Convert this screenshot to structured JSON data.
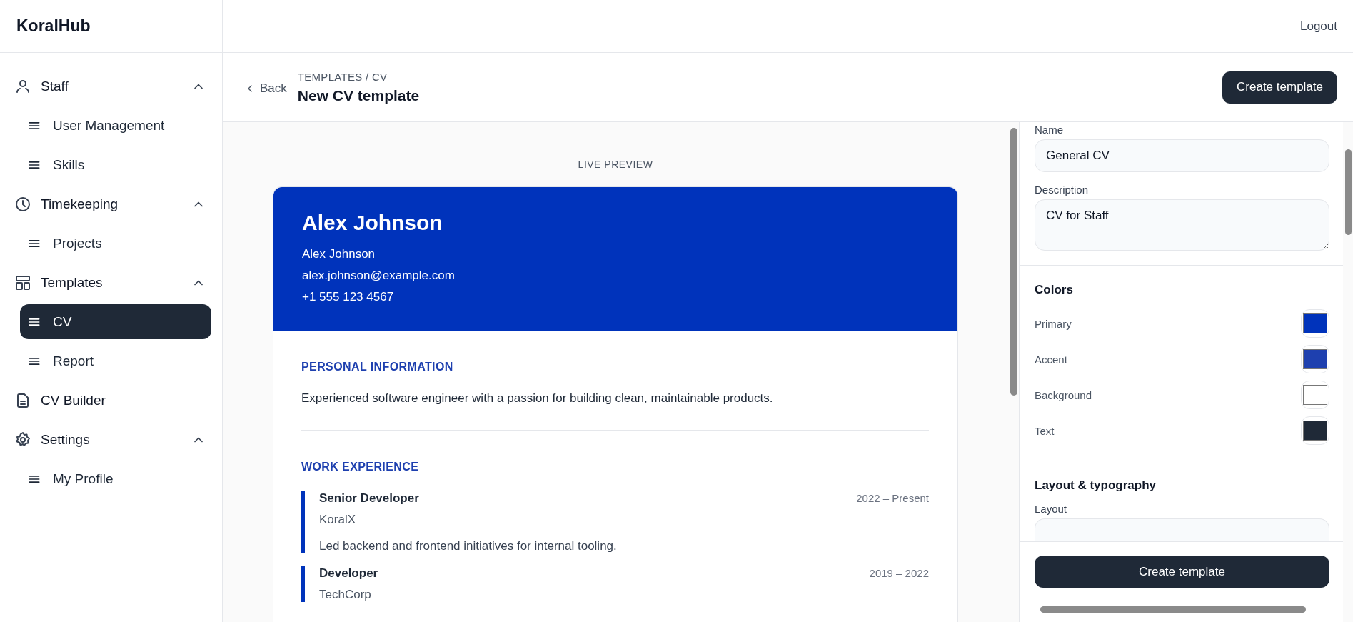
{
  "brand": "KoralHub",
  "topbar": {
    "logout": "Logout"
  },
  "sidebar": {
    "items": [
      {
        "kind": "group",
        "label": "Staff",
        "expanded": true,
        "children": [
          {
            "label": "User Management",
            "selected": false
          },
          {
            "label": "Skills",
            "selected": false
          }
        ]
      },
      {
        "kind": "group",
        "label": "Timekeeping",
        "expanded": true,
        "children": [
          {
            "label": "Projects",
            "selected": false
          }
        ]
      },
      {
        "kind": "group",
        "label": "Templates",
        "expanded": true,
        "children": [
          {
            "label": "CV",
            "selected": true
          },
          {
            "label": "Report",
            "selected": false
          }
        ]
      },
      {
        "kind": "link",
        "label": "CV Builder",
        "selected": false
      },
      {
        "kind": "group",
        "label": "Settings",
        "expanded": true,
        "children": [
          {
            "label": "My Profile",
            "selected": false
          }
        ]
      }
    ]
  },
  "header": {
    "back": "Back",
    "breadcrumb": "TEMPLATES / CV",
    "title": "New CV template",
    "action": "Create template"
  },
  "preview": {
    "label": "LIVE PREVIEW",
    "cv": {
      "name": "Alex Johnson",
      "contact": [
        "Alex Johnson",
        "alex.johnson@example.com",
        "+1 555 123 4567"
      ],
      "sections": [
        {
          "kind": "text",
          "title": "PERSONAL INFORMATION",
          "text": "Experienced software engineer with a passion for building clean, maintainable products."
        },
        {
          "kind": "entries",
          "title": "WORK EXPERIENCE",
          "entries": [
            {
              "role": "Senior Developer",
              "period": "2022 – Present",
              "company": "KoralX",
              "description": "Led backend and frontend initiatives for internal tooling."
            },
            {
              "role": "Developer",
              "period": "2019 – 2022",
              "company": "TechCorp"
            }
          ]
        }
      ]
    }
  },
  "form": {
    "name_label": "Name",
    "name_value": "General CV",
    "description_label": "Description",
    "description_value": "CV for Staff",
    "colors_title": "Colors",
    "colors": [
      {
        "label": "Primary",
        "color": "#0033bb"
      },
      {
        "label": "Accent",
        "color": "#1e40af"
      },
      {
        "label": "Background",
        "color": "#ffffff"
      },
      {
        "label": "Text",
        "color": "#1f2937"
      }
    ],
    "layout_title": "Layout & typography",
    "layout_label": "Layout",
    "submit": "Create template"
  }
}
